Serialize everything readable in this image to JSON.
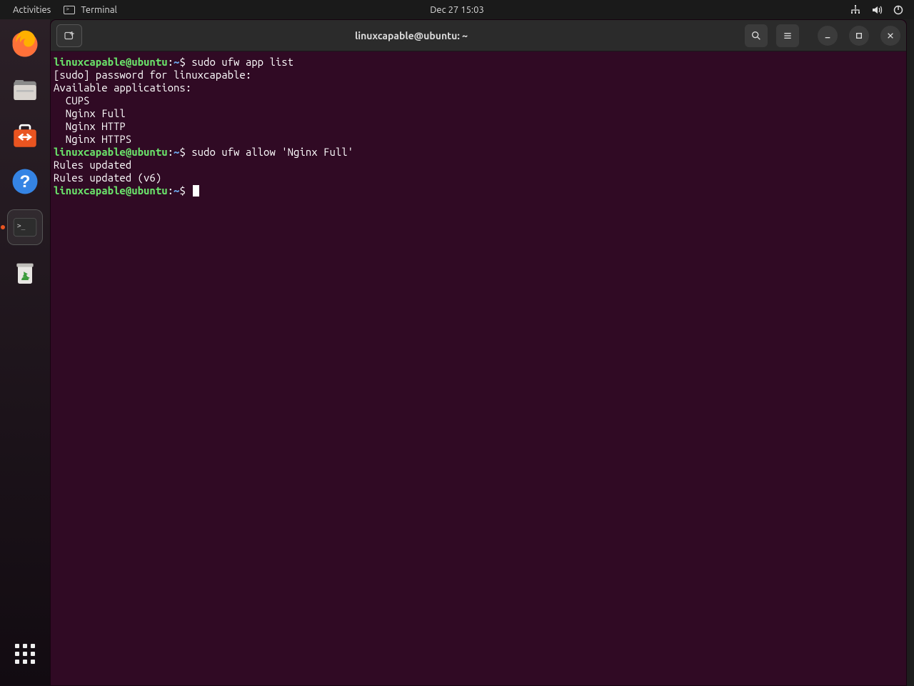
{
  "topbar": {
    "activities": "Activities",
    "app_label": "Terminal",
    "clock": "Dec 27  15:03"
  },
  "window": {
    "title": "linuxcapable@ubuntu: ~"
  },
  "prompt": {
    "user": "linuxcapable",
    "at": "@",
    "host": "ubuntu",
    "colon": ":",
    "path": "~",
    "sym": "$"
  },
  "cmds": {
    "c1": " sudo ufw app list",
    "c2": " sudo ufw allow 'Nginx Full'",
    "c3": " "
  },
  "out": {
    "l1": "[sudo] password for linuxcapable:",
    "l2": "Available applications:",
    "l3": "  CUPS",
    "l4": "  Nginx Full",
    "l5": "  Nginx HTTP",
    "l6": "  Nginx HTTPS",
    "l7": "Rules updated",
    "l8": "Rules updated (v6)"
  },
  "dock": {
    "items": [
      "firefox",
      "files",
      "software",
      "help",
      "terminal",
      "trash"
    ]
  }
}
